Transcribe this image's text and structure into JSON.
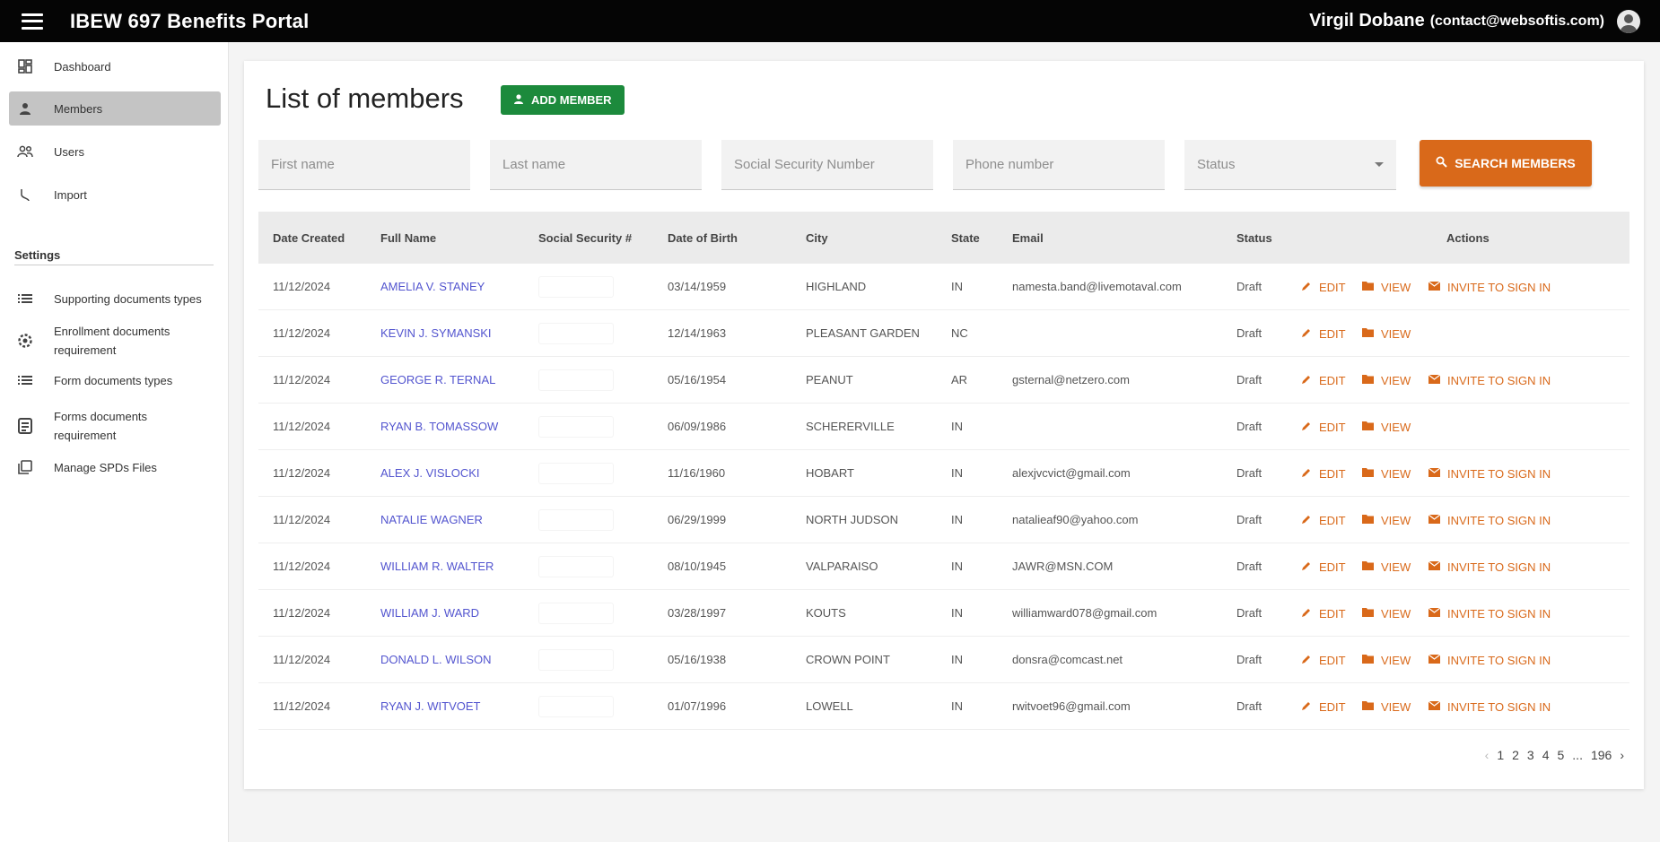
{
  "header": {
    "title": "IBEW 697 Benefits Portal",
    "user_name": "Virgil Dobane",
    "user_email": "(contact@websoftis.com)"
  },
  "sidebar": {
    "items": [
      {
        "label": "Dashboard",
        "icon": "dashboard-icon"
      },
      {
        "label": "Members",
        "icon": "person-icon"
      },
      {
        "label": "Users",
        "icon": "people-icon"
      },
      {
        "label": "Import",
        "icon": "import-icon"
      }
    ],
    "settings_heading": "Settings",
    "settings_items": [
      {
        "label": "Supporting documents types",
        "icon": "list-icon"
      },
      {
        "label": "Enrollment documents requirement",
        "icon": "gear-icon"
      },
      {
        "label": "Form documents types",
        "icon": "list-icon"
      },
      {
        "label": "Forms documents requirement",
        "icon": "document-icon"
      },
      {
        "label": "Manage SPDs Files",
        "icon": "files-icon"
      }
    ]
  },
  "main": {
    "title": "List of members",
    "add_button": "ADD MEMBER",
    "filters": {
      "first_name": "First name",
      "last_name": "Last name",
      "ssn": "Social Security Number",
      "phone": "Phone number",
      "status": "Status"
    },
    "search_button": "SEARCH MEMBERS",
    "columns": [
      "Date Created",
      "Full Name",
      "Social Security #",
      "Date of Birth",
      "City",
      "State",
      "Email",
      "Status",
      "Actions"
    ],
    "actions": {
      "edit": "EDIT",
      "view": "VIEW",
      "invite": "INVITE TO SIGN IN"
    },
    "rows": [
      {
        "date": "11/12/2024",
        "name": "AMELIA V. STANEY",
        "dob": "03/14/1959",
        "city": "HIGHLAND",
        "state": "IN",
        "email": "namesta.band@livemotaval.com",
        "status": "Draft",
        "invite": true
      },
      {
        "date": "11/12/2024",
        "name": "KEVIN J. SYMANSKI",
        "dob": "12/14/1963",
        "city": "PLEASANT GARDEN",
        "state": "NC",
        "email": "",
        "status": "Draft",
        "invite": false
      },
      {
        "date": "11/12/2024",
        "name": "GEORGE R. TERNAL",
        "dob": "05/16/1954",
        "city": "PEANUT",
        "state": "AR",
        "email": "gsternal@netzero.com",
        "status": "Draft",
        "invite": true
      },
      {
        "date": "11/12/2024",
        "name": "RYAN B. TOMASSOW",
        "dob": "06/09/1986",
        "city": "SCHERERVILLE",
        "state": "IN",
        "email": "",
        "status": "Draft",
        "invite": false
      },
      {
        "date": "11/12/2024",
        "name": "ALEX J. VISLOCKI",
        "dob": "11/16/1960",
        "city": "HOBART",
        "state": "IN",
        "email": "alexjvcvict@gmail.com",
        "status": "Draft",
        "invite": true
      },
      {
        "date": "11/12/2024",
        "name": "NATALIE WAGNER",
        "dob": "06/29/1999",
        "city": "NORTH JUDSON",
        "state": "IN",
        "email": "natalieaf90@yahoo.com",
        "status": "Draft",
        "invite": true
      },
      {
        "date": "11/12/2024",
        "name": "WILLIAM R. WALTER",
        "dob": "08/10/1945",
        "city": "VALPARAISO",
        "state": "IN",
        "email": "JAWR@MSN.COM",
        "status": "Draft",
        "invite": true
      },
      {
        "date": "11/12/2024",
        "name": "WILLIAM J. WARD",
        "dob": "03/28/1997",
        "city": "KOUTS",
        "state": "IN",
        "email": "williamward078@gmail.com",
        "status": "Draft",
        "invite": true
      },
      {
        "date": "11/12/2024",
        "name": "DONALD L. WILSON",
        "dob": "05/16/1938",
        "city": "CROWN POINT",
        "state": "IN",
        "email": "donsra@comcast.net",
        "status": "Draft",
        "invite": true
      },
      {
        "date": "11/12/2024",
        "name": "RYAN J. WITVOET",
        "dob": "01/07/1996",
        "city": "LOWELL",
        "state": "IN",
        "email": "rwitvoet96@gmail.com",
        "status": "Draft",
        "invite": true
      }
    ],
    "pagination": {
      "pages": [
        "1",
        "2",
        "3",
        "4",
        "5"
      ],
      "ellipsis": "...",
      "last": "196"
    }
  },
  "colors": {
    "accent_orange": "#d9691a",
    "add_green": "#1c8a3c",
    "link_blue": "#5355cf"
  }
}
